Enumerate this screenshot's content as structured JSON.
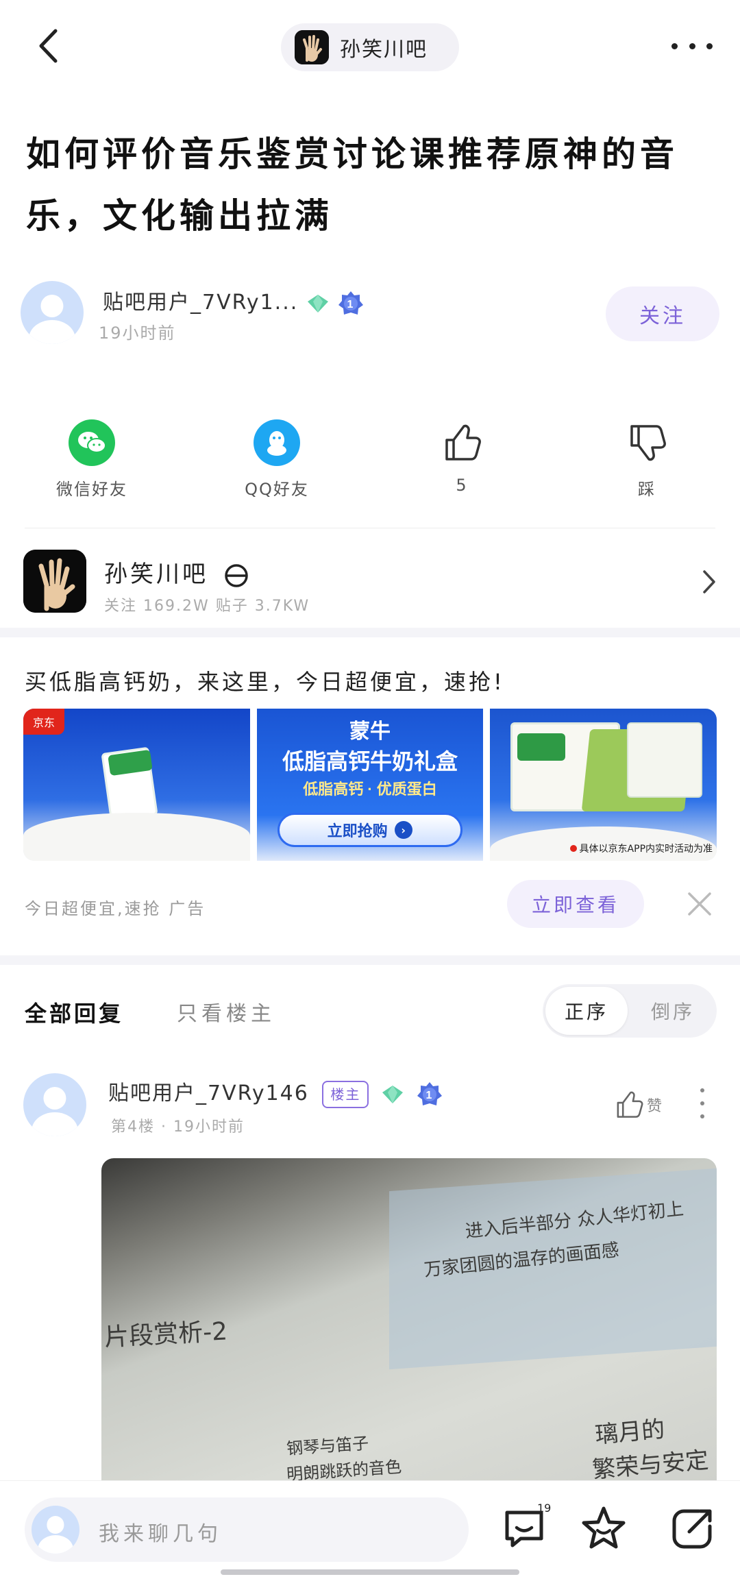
{
  "header": {
    "forum_chip_name": "孙笑川吧"
  },
  "post": {
    "title": "如何评价音乐鉴赏讨论课推荐原神的音乐，文化输出拉满",
    "author_name": "贴吧用户_7VRy1...",
    "author_level": "1",
    "time": "19小时前",
    "follow_label": "关注"
  },
  "actions": {
    "wechat_label": "微信好友",
    "qq_label": "QQ好友",
    "like_count": "5",
    "dislike_label": "踩"
  },
  "forum": {
    "name": "孙笑川吧",
    "stats": "关注 169.2W   贴子 3.7KW"
  },
  "ad": {
    "title": "买低脂高钙奶，来这里，今日超便宜，速抢!",
    "img_b_brand": "蒙牛",
    "img_b_headline": "低脂高钙牛奶礼盒",
    "img_b_sub": "低脂高钙 · 优质蛋白",
    "img_b_button": "立即抢购",
    "img_c_note": "具体以京东APP内实时活动为准",
    "jd_label": "京东",
    "footer_label": "今日超便宜,速抢  广告",
    "view_label": "立即查看"
  },
  "replies": {
    "tab_all": "全部回复",
    "tab_host": "只看楼主",
    "sort_asc": "正序",
    "sort_desc": "倒序"
  },
  "reply": {
    "user": "贴吧用户_7VRy146",
    "host_tag": "楼主",
    "level": "1",
    "meta": "第4楼  ·  19小时前",
    "like_label": "赞",
    "photo_text_1": "片段赏析-2",
    "photo_text_2": "进入后半部分  众人华灯初上",
    "photo_text_3": "万家团圆的温存的画面感",
    "photo_text_4": "钢琴与笛子",
    "photo_text_5": "明朗跳跃的音色",
    "photo_text_6": "璃月的",
    "photo_text_7": "繁荣与安定"
  },
  "bottom": {
    "input_placeholder": "我来聊几句",
    "comment_count": "19"
  }
}
